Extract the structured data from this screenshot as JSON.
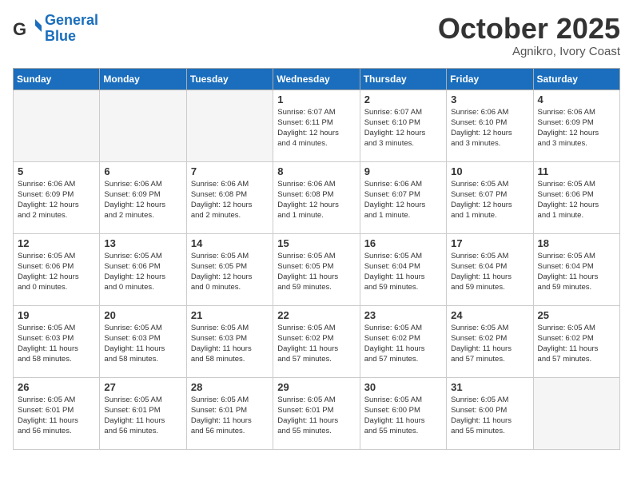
{
  "header": {
    "logo_general": "General",
    "logo_blue": "Blue",
    "month": "October 2025",
    "location": "Agnikro, Ivory Coast"
  },
  "days_of_week": [
    "Sunday",
    "Monday",
    "Tuesday",
    "Wednesday",
    "Thursday",
    "Friday",
    "Saturday"
  ],
  "weeks": [
    [
      {
        "day": "",
        "info": ""
      },
      {
        "day": "",
        "info": ""
      },
      {
        "day": "",
        "info": ""
      },
      {
        "day": "1",
        "info": "Sunrise: 6:07 AM\nSunset: 6:11 PM\nDaylight: 12 hours\nand 4 minutes."
      },
      {
        "day": "2",
        "info": "Sunrise: 6:07 AM\nSunset: 6:10 PM\nDaylight: 12 hours\nand 3 minutes."
      },
      {
        "day": "3",
        "info": "Sunrise: 6:06 AM\nSunset: 6:10 PM\nDaylight: 12 hours\nand 3 minutes."
      },
      {
        "day": "4",
        "info": "Sunrise: 6:06 AM\nSunset: 6:09 PM\nDaylight: 12 hours\nand 3 minutes."
      }
    ],
    [
      {
        "day": "5",
        "info": "Sunrise: 6:06 AM\nSunset: 6:09 PM\nDaylight: 12 hours\nand 2 minutes."
      },
      {
        "day": "6",
        "info": "Sunrise: 6:06 AM\nSunset: 6:09 PM\nDaylight: 12 hours\nand 2 minutes."
      },
      {
        "day": "7",
        "info": "Sunrise: 6:06 AM\nSunset: 6:08 PM\nDaylight: 12 hours\nand 2 minutes."
      },
      {
        "day": "8",
        "info": "Sunrise: 6:06 AM\nSunset: 6:08 PM\nDaylight: 12 hours\nand 1 minute."
      },
      {
        "day": "9",
        "info": "Sunrise: 6:06 AM\nSunset: 6:07 PM\nDaylight: 12 hours\nand 1 minute."
      },
      {
        "day": "10",
        "info": "Sunrise: 6:05 AM\nSunset: 6:07 PM\nDaylight: 12 hours\nand 1 minute."
      },
      {
        "day": "11",
        "info": "Sunrise: 6:05 AM\nSunset: 6:06 PM\nDaylight: 12 hours\nand 1 minute."
      }
    ],
    [
      {
        "day": "12",
        "info": "Sunrise: 6:05 AM\nSunset: 6:06 PM\nDaylight: 12 hours\nand 0 minutes."
      },
      {
        "day": "13",
        "info": "Sunrise: 6:05 AM\nSunset: 6:06 PM\nDaylight: 12 hours\nand 0 minutes."
      },
      {
        "day": "14",
        "info": "Sunrise: 6:05 AM\nSunset: 6:05 PM\nDaylight: 12 hours\nand 0 minutes."
      },
      {
        "day": "15",
        "info": "Sunrise: 6:05 AM\nSunset: 6:05 PM\nDaylight: 11 hours\nand 59 minutes."
      },
      {
        "day": "16",
        "info": "Sunrise: 6:05 AM\nSunset: 6:04 PM\nDaylight: 11 hours\nand 59 minutes."
      },
      {
        "day": "17",
        "info": "Sunrise: 6:05 AM\nSunset: 6:04 PM\nDaylight: 11 hours\nand 59 minutes."
      },
      {
        "day": "18",
        "info": "Sunrise: 6:05 AM\nSunset: 6:04 PM\nDaylight: 11 hours\nand 59 minutes."
      }
    ],
    [
      {
        "day": "19",
        "info": "Sunrise: 6:05 AM\nSunset: 6:03 PM\nDaylight: 11 hours\nand 58 minutes."
      },
      {
        "day": "20",
        "info": "Sunrise: 6:05 AM\nSunset: 6:03 PM\nDaylight: 11 hours\nand 58 minutes."
      },
      {
        "day": "21",
        "info": "Sunrise: 6:05 AM\nSunset: 6:03 PM\nDaylight: 11 hours\nand 58 minutes."
      },
      {
        "day": "22",
        "info": "Sunrise: 6:05 AM\nSunset: 6:02 PM\nDaylight: 11 hours\nand 57 minutes."
      },
      {
        "day": "23",
        "info": "Sunrise: 6:05 AM\nSunset: 6:02 PM\nDaylight: 11 hours\nand 57 minutes."
      },
      {
        "day": "24",
        "info": "Sunrise: 6:05 AM\nSunset: 6:02 PM\nDaylight: 11 hours\nand 57 minutes."
      },
      {
        "day": "25",
        "info": "Sunrise: 6:05 AM\nSunset: 6:02 PM\nDaylight: 11 hours\nand 57 minutes."
      }
    ],
    [
      {
        "day": "26",
        "info": "Sunrise: 6:05 AM\nSunset: 6:01 PM\nDaylight: 11 hours\nand 56 minutes."
      },
      {
        "day": "27",
        "info": "Sunrise: 6:05 AM\nSunset: 6:01 PM\nDaylight: 11 hours\nand 56 minutes."
      },
      {
        "day": "28",
        "info": "Sunrise: 6:05 AM\nSunset: 6:01 PM\nDaylight: 11 hours\nand 56 minutes."
      },
      {
        "day": "29",
        "info": "Sunrise: 6:05 AM\nSunset: 6:01 PM\nDaylight: 11 hours\nand 55 minutes."
      },
      {
        "day": "30",
        "info": "Sunrise: 6:05 AM\nSunset: 6:00 PM\nDaylight: 11 hours\nand 55 minutes."
      },
      {
        "day": "31",
        "info": "Sunrise: 6:05 AM\nSunset: 6:00 PM\nDaylight: 11 hours\nand 55 minutes."
      },
      {
        "day": "",
        "info": ""
      }
    ]
  ]
}
